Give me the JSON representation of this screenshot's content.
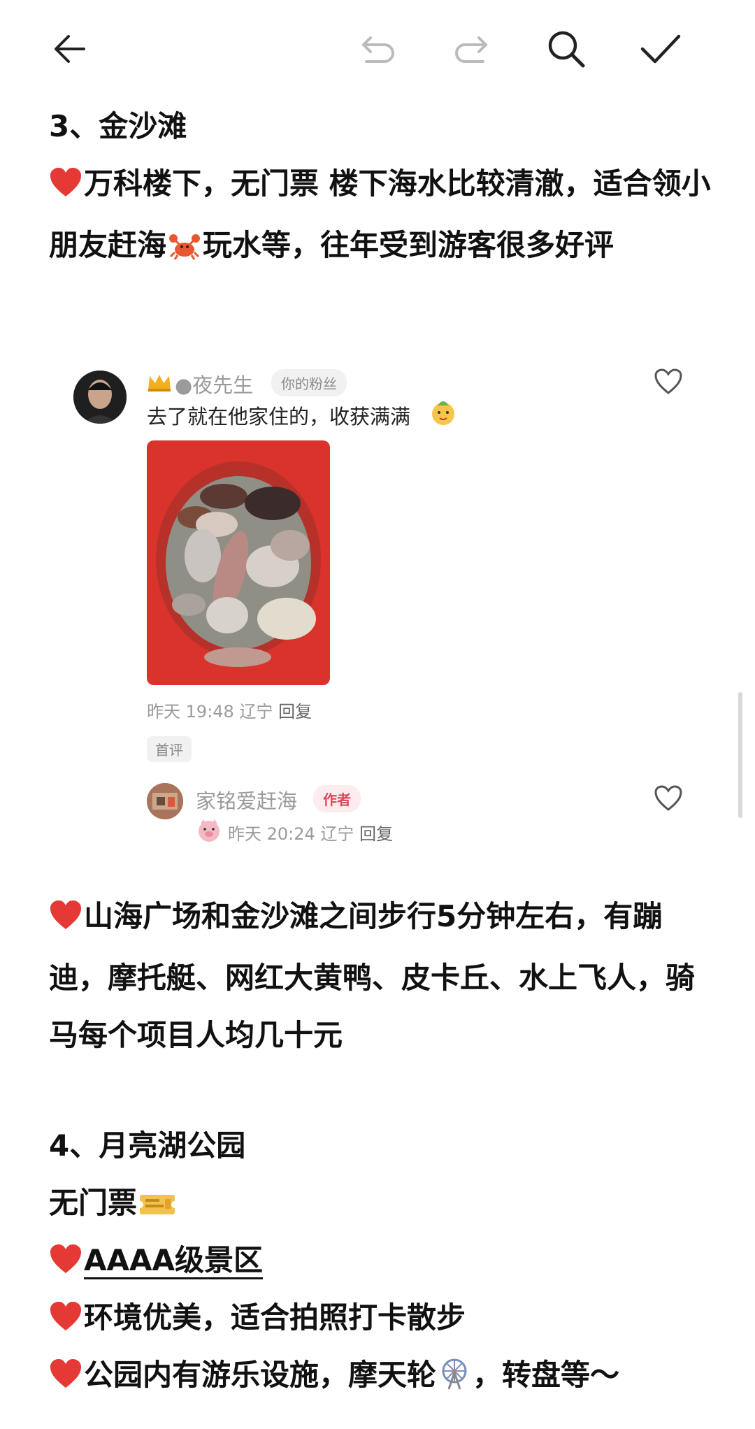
{
  "toolbar": {
    "back_icon": "arrow-left-icon",
    "undo_icon": "undo-icon",
    "redo_icon": "redo-icon",
    "search_icon": "search-icon",
    "confirm_icon": "checkmark-icon"
  },
  "section3": {
    "title": "3、金沙滩",
    "p1_a": "万科楼下，无门票 楼下海水比较清澈，适合领小朋友赶海",
    "p1_b": "玩水等，往年受到游客很多好评",
    "p2": "山海广场和金沙滩之间步行5分钟左右，有蹦迪，摩托艇、网红大黄鸭、皮卡丘、水上飞人，骑马每个项目人均几十元"
  },
  "comment": {
    "user_name": "●夜先生",
    "user_badge": "你的粉丝",
    "text": "去了就在他家住的，收获满满",
    "meta_time": "昨天 19:48",
    "meta_location": "辽宁",
    "reply_label": "回复",
    "first_tag": "首评",
    "reply": {
      "user_name": "家铭爱赶海",
      "author_badge": "作者",
      "meta_time": "昨天 20:24",
      "meta_location": "辽宁",
      "reply_label": "回复"
    }
  },
  "section4": {
    "title": "4、月亮湖公园",
    "line1": "无门票",
    "line2": "AAAA级景区",
    "line3": "环境优美，适合拍照打卡散步",
    "line4_a": "公园内有游乐设施，摩天轮",
    "line4_b": "，转盘等～"
  },
  "colors": {
    "heart": "#e53935",
    "author_badge": "#e0455a",
    "gray_text": "#9a9a9a"
  }
}
